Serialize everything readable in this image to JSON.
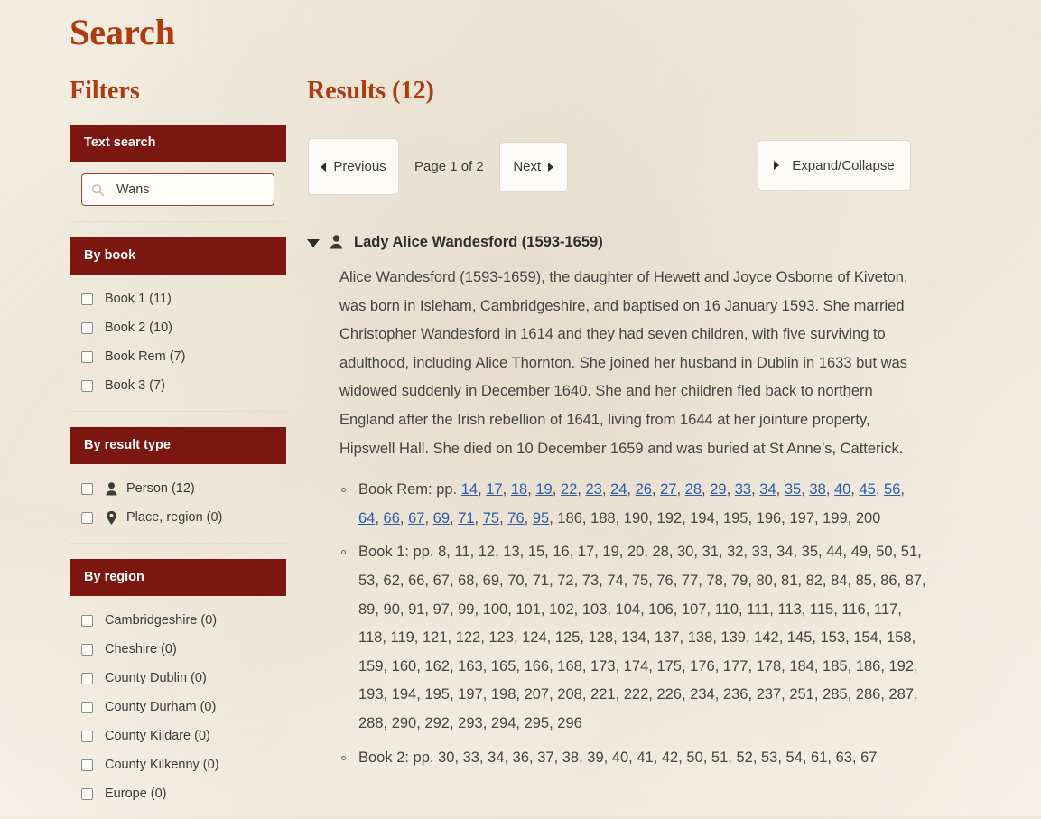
{
  "page": {
    "title": "Search",
    "filters_title": "Filters",
    "results_title": "Results (12)"
  },
  "colors": {
    "heading": "#ae3c10",
    "facet_header_bg": "#7b1710",
    "link": "#2a5caa",
    "background": "#faf6ee"
  },
  "filters": {
    "text_search": {
      "header": "Text search",
      "icon": "search-icon",
      "value": "Wans",
      "placeholder": "Wans"
    },
    "by_book": {
      "header": "By book",
      "options": [
        {
          "label": "Book 1 (11)",
          "checked": false
        },
        {
          "label": "Book 2 (10)",
          "checked": false
        },
        {
          "label": "Book Rem (7)",
          "checked": false
        },
        {
          "label": "Book 3 (7)",
          "checked": false
        }
      ]
    },
    "by_result_type": {
      "header": "By result type",
      "options": [
        {
          "label": "Person (12)",
          "icon": "person-icon",
          "checked": false
        },
        {
          "label": "Place, region (0)",
          "icon": "map-pin-icon",
          "checked": false
        }
      ]
    },
    "by_region": {
      "header": "By region",
      "options": [
        {
          "label": "Cambridgeshire (0)",
          "checked": false
        },
        {
          "label": "Cheshire (0)",
          "checked": false
        },
        {
          "label": "County Dublin (0)",
          "checked": false
        },
        {
          "label": "County Durham (0)",
          "checked": false
        },
        {
          "label": "County Kildare (0)",
          "checked": false
        },
        {
          "label": "County Kilkenny (0)",
          "checked": false
        },
        {
          "label": "Europe (0)",
          "checked": false
        }
      ]
    }
  },
  "pagination": {
    "previous_label": "Previous",
    "page_indicator": "Page 1 of 2",
    "next_label": "Next",
    "expand_collapse_label": "Expand/Collapse"
  },
  "results": [
    {
      "name": "Lady Alice Wandesford (1593-1659)",
      "icon": "person-icon",
      "expanded": true,
      "description": "Alice Wandesford (1593-1659), the daughter of Hewett and Joyce Osborne of Kiveton, was born in Isleham, Cambridgeshire, and baptised on 16 January 1593. She married Christopher Wandesford in 1614 and they had seven children, with five surviving to adulthood, including Alice Thornton. She joined her husband in Dublin in 1633 but was widowed suddenly in December 1640. She and her children fled back to northern England after the Irish rebellion of 1641, living from 1644 at her jointure property, Hipswell Hall. She died on 10 December 1659 and was buried at St Anne’s, Catterick.",
      "occurrences": [
        {
          "label": "Book Rem: pp.",
          "linked_pages": [
            14,
            17,
            18,
            19,
            22,
            23,
            24,
            26,
            27,
            28,
            29,
            33,
            34,
            35,
            38,
            40,
            45,
            56,
            64,
            66,
            67,
            69,
            71,
            75,
            76,
            95
          ],
          "plain_pages": [
            186,
            188,
            190,
            192,
            194,
            195,
            196,
            197,
            199,
            200
          ]
        },
        {
          "label": "Book 1: pp.",
          "linked_pages": [],
          "plain_pages": [
            8,
            11,
            12,
            13,
            15,
            16,
            17,
            19,
            20,
            28,
            30,
            31,
            32,
            33,
            34,
            35,
            44,
            49,
            50,
            51,
            53,
            62,
            66,
            67,
            68,
            69,
            70,
            71,
            72,
            73,
            74,
            75,
            76,
            77,
            78,
            79,
            80,
            81,
            82,
            84,
            85,
            86,
            87,
            89,
            90,
            91,
            97,
            99,
            100,
            101,
            102,
            103,
            104,
            106,
            107,
            110,
            111,
            113,
            115,
            116,
            117,
            118,
            119,
            121,
            122,
            123,
            124,
            125,
            128,
            134,
            137,
            138,
            139,
            142,
            145,
            153,
            154,
            158,
            159,
            160,
            162,
            163,
            165,
            166,
            168,
            173,
            174,
            175,
            176,
            177,
            178,
            184,
            185,
            186,
            192,
            193,
            194,
            195,
            197,
            198,
            207,
            208,
            221,
            222,
            226,
            234,
            236,
            237,
            251,
            285,
            286,
            287,
            288,
            290,
            292,
            293,
            294,
            295,
            296
          ]
        },
        {
          "label": "Book 2: pp.",
          "linked_pages": [],
          "plain_pages": [
            30,
            33,
            34,
            36,
            37,
            38,
            39,
            40,
            41,
            42,
            50,
            51,
            52,
            53,
            54,
            61,
            63,
            67
          ]
        }
      ]
    }
  ]
}
